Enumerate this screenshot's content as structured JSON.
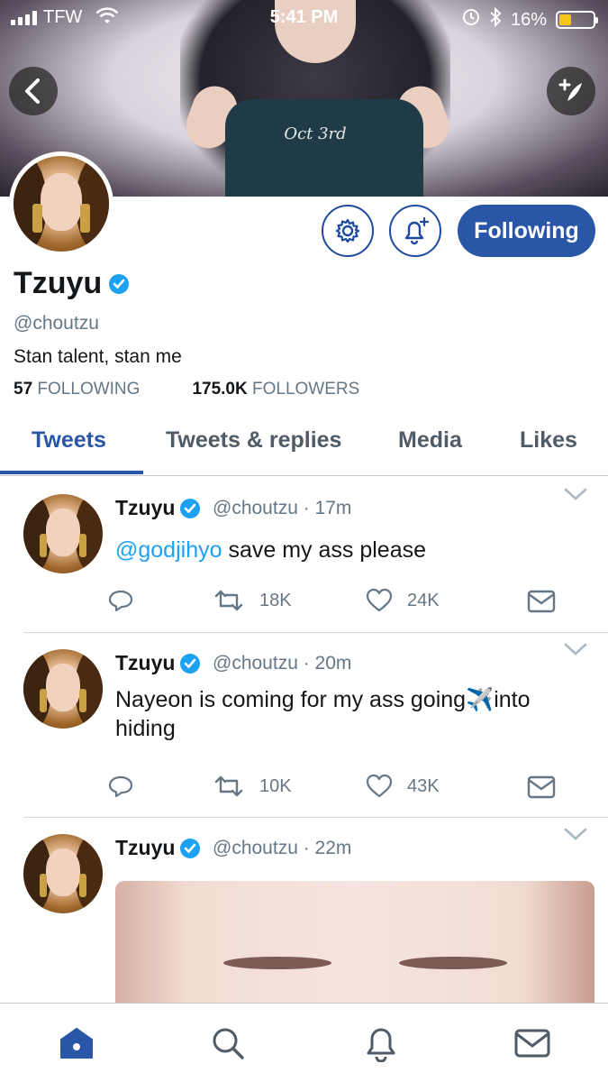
{
  "status_bar": {
    "carrier": "TFW",
    "time": "5:41 PM",
    "battery": "16%",
    "battery_level": 0.16
  },
  "profile": {
    "name": "Tzuyu",
    "handle": "@choutzu",
    "bio": "Stan talent, stan me",
    "following_count": "57",
    "following_label": "FOLLOWING",
    "followers_count": "175.0K",
    "followers_label": "FOLLOWERS",
    "follow_button": "Following",
    "banner_text": "Oct 3rd"
  },
  "tabs": [
    {
      "label": "Tweets",
      "active": true
    },
    {
      "label": "Tweets & replies",
      "active": false
    },
    {
      "label": "Media",
      "active": false
    },
    {
      "label": "Likes",
      "active": false
    }
  ],
  "tweets": [
    {
      "name": "Tzuyu",
      "meta": "@choutzu · 17m",
      "mention": "@godjihyo",
      "text": " save my ass please",
      "retweets": "18K",
      "likes": "24K"
    },
    {
      "name": "Tzuyu",
      "meta": "@choutzu · 20m",
      "text": "Nayeon is coming for my ass going✈️into hiding",
      "retweets": "10K",
      "likes": "43K"
    },
    {
      "name": "Tzuyu",
      "meta": "@choutzu · 22m"
    }
  ],
  "colors": {
    "accent": "#2a56a8",
    "link": "#1da1f2",
    "muted": "#657786"
  },
  "bottom_nav": [
    "home-icon",
    "search-icon",
    "notifications-icon",
    "messages-icon"
  ]
}
